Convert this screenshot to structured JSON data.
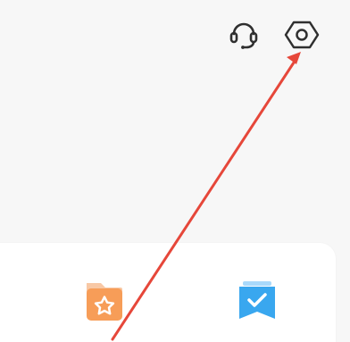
{
  "icons": {
    "support": "headset-icon",
    "settings": "hexagon-settings-icon",
    "favorites": "folder-star-icon",
    "todo": "bookmark-check-icon"
  },
  "colors": {
    "background": "#f7f7f7",
    "panel": "#ffffff",
    "icon_dark": "#2f2f2f",
    "favorites_orange": "#f79d58",
    "favorites_orange_dark": "#ef7f43",
    "todo_blue": "#39a7ef",
    "todo_blue_light": "#a9d9fb",
    "annotation_red": "#e6473a"
  }
}
